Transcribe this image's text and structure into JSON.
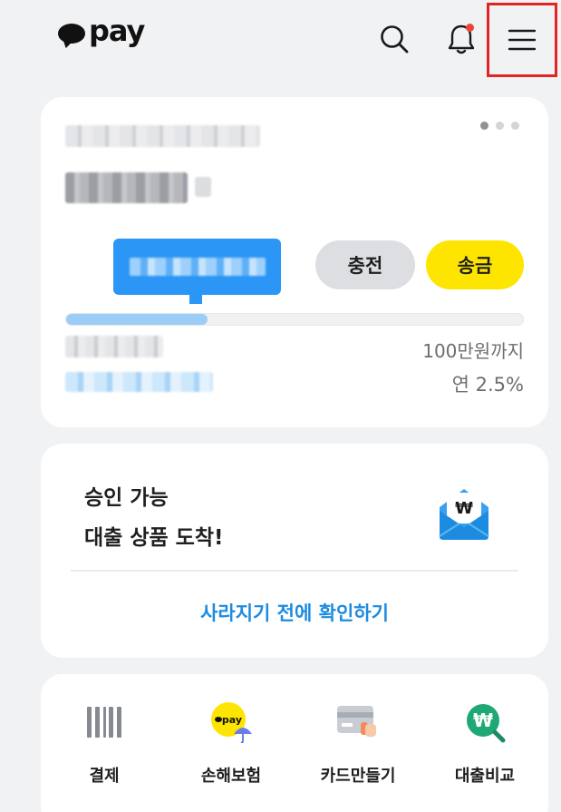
{
  "header": {
    "logo_text": "pay",
    "icons": [
      "chat-bubble-logo",
      "search-icon",
      "bell-icon",
      "hamburger-menu-icon"
    ]
  },
  "account_card": {
    "page_indicator": {
      "count": 3,
      "active": 0
    },
    "charge_label": "충전",
    "send_label": "송금",
    "limit_text": "100만원까지",
    "rate_text": "연 2.5%",
    "progress_fraction": 0.31
  },
  "loan_card": {
    "title_line1": "승인 가능",
    "title_line2": "대출 상품 도착!",
    "link_label": "사라지기 전에 확인하기",
    "icon": "won-envelope-icon"
  },
  "quick_menu": [
    {
      "label": "결제",
      "icon": "barcode-icon"
    },
    {
      "label": "손해보험",
      "icon": "pay-umbrella-icon"
    },
    {
      "label": "카드만들기",
      "icon": "card-icon"
    },
    {
      "label": "대출비교",
      "icon": "won-search-icon"
    }
  ],
  "colors": {
    "background": "#f1f2f4",
    "brand_yellow": "#fee500",
    "link_blue": "#1d8ce0",
    "tooltip_blue": "#2b96f5",
    "highlight_red": "#e32424",
    "notification_dot": "#f0413b"
  }
}
